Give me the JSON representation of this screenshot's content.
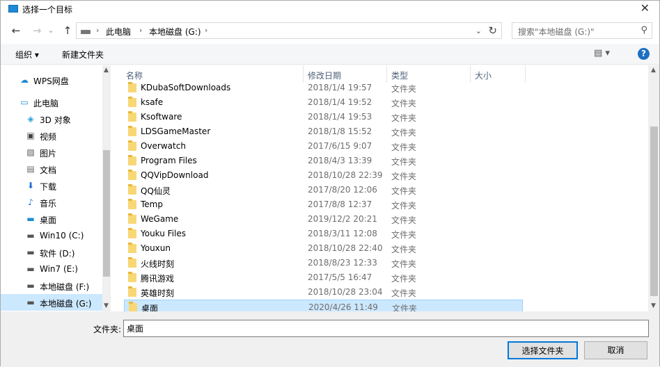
{
  "window": {
    "title": "选择一个目标",
    "close": "✕"
  },
  "nav_buttons": {
    "back": "←",
    "forward": "→",
    "recent": "⌄",
    "up": "↑"
  },
  "address": {
    "sep": "›",
    "crumbs": [
      "此电脑",
      "本地磁盘 (G:)"
    ],
    "dropdown": "⌄",
    "refresh": "↻"
  },
  "search": {
    "placeholder": "搜索\"本地磁盘 (G:)\"",
    "icon": "⚲"
  },
  "toolbar": {
    "organize": "组织 ▾",
    "new_folder": "新建文件夹",
    "view": "▤ ▾",
    "help": "?"
  },
  "sidebar": {
    "items": [
      {
        "label": "WPS网盘",
        "icon": "cloud-icon",
        "glyph": "☁"
      },
      {
        "label": "此电脑",
        "icon": "computer-icon",
        "glyph": "▭"
      },
      {
        "label": "3D 对象",
        "icon": "cube-icon",
        "glyph": "◈"
      },
      {
        "label": "视频",
        "icon": "video-icon",
        "glyph": "▣"
      },
      {
        "label": "图片",
        "icon": "picture-icon",
        "glyph": "▨"
      },
      {
        "label": "文档",
        "icon": "document-icon",
        "glyph": "▤"
      },
      {
        "label": "下载",
        "icon": "download-icon",
        "glyph": "⬇"
      },
      {
        "label": "音乐",
        "icon": "music-icon",
        "glyph": "♪"
      },
      {
        "label": "桌面",
        "icon": "desktop-icon",
        "glyph": "▬"
      },
      {
        "label": "Win10 (C:)",
        "icon": "drive-icon",
        "glyph": "▬"
      },
      {
        "label": "软件 (D:)",
        "icon": "drive-icon",
        "glyph": "▬"
      },
      {
        "label": "Win7 (E:)",
        "icon": "drive-icon",
        "glyph": "▬"
      },
      {
        "label": "本地磁盘 (F:)",
        "icon": "drive-icon",
        "glyph": "▬"
      },
      {
        "label": "本地磁盘 (G:)",
        "icon": "drive-icon",
        "glyph": "▬",
        "selected": true
      }
    ]
  },
  "columns": {
    "name": "名称",
    "modified": "修改日期",
    "type": "类型",
    "size": "大小",
    "sort_caret": "^"
  },
  "files": [
    {
      "name": "KDubaSoftDownloads",
      "date": "2018/1/4 19:57",
      "type": "文件夹"
    },
    {
      "name": "ksafe",
      "date": "2018/1/4 19:52",
      "type": "文件夹"
    },
    {
      "name": "Ksoftware",
      "date": "2018/1/4 19:53",
      "type": "文件夹"
    },
    {
      "name": "LDSGameMaster",
      "date": "2018/1/8 15:52",
      "type": "文件夹"
    },
    {
      "name": "Overwatch",
      "date": "2017/6/15 9:07",
      "type": "文件夹"
    },
    {
      "name": "Program Files",
      "date": "2018/4/3 13:39",
      "type": "文件夹"
    },
    {
      "name": "QQVipDownload",
      "date": "2018/10/28 22:39",
      "type": "文件夹"
    },
    {
      "name": "QQ仙灵",
      "date": "2017/8/20 12:06",
      "type": "文件夹"
    },
    {
      "name": "Temp",
      "date": "2017/8/8 12:37",
      "type": "文件夹"
    },
    {
      "name": "WeGame",
      "date": "2019/12/2 20:21",
      "type": "文件夹"
    },
    {
      "name": "Youku Files",
      "date": "2018/3/11 12:08",
      "type": "文件夹"
    },
    {
      "name": "Youxun",
      "date": "2018/10/28 22:40",
      "type": "文件夹"
    },
    {
      "name": "火线时刻",
      "date": "2018/8/23 12:33",
      "type": "文件夹"
    },
    {
      "name": "腾讯游戏",
      "date": "2017/5/5 16:47",
      "type": "文件夹"
    },
    {
      "name": "英雄时刻",
      "date": "2018/10/28 23:04",
      "type": "文件夹"
    },
    {
      "name": "桌面",
      "date": "2020/4/26 11:49",
      "type": "文件夹",
      "selected": true
    }
  ],
  "bottom": {
    "folder_label": "文件夹:",
    "folder_value": "桌面",
    "select_button": "选择文件夹",
    "cancel_button": "取消"
  },
  "scroll": {
    "up": "▲",
    "down": "▼"
  }
}
